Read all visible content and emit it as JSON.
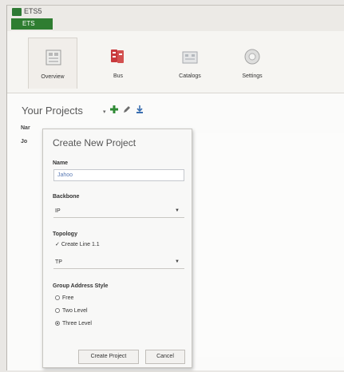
{
  "window": {
    "title": "ETS5"
  },
  "tab_strip": {
    "active_tab": "ETS"
  },
  "ribbon": {
    "tabs": [
      {
        "label": "Overview",
        "icon": "overview-icon",
        "active": true
      },
      {
        "label": "Bus",
        "icon": "bus-icon",
        "active": false
      },
      {
        "label": "Catalogs",
        "icon": "catalogs-icon",
        "active": false
      },
      {
        "label": "Settings",
        "icon": "settings-icon",
        "active": false
      }
    ]
  },
  "projects": {
    "title": "Your Projects",
    "bg_col": "Nar",
    "bg_row": "Jo"
  },
  "dialog": {
    "title": "Create New Project",
    "name_label": "Name",
    "name_value": "Jahoo",
    "backbone_label": "Backbone",
    "backbone_value": "IP",
    "topology_label": "Topology",
    "create_line_label": "Create Line 1.1",
    "topology_value": "TP",
    "group_label": "Group Address Style",
    "radios": [
      {
        "label": "Free",
        "selected": false
      },
      {
        "label": "Two Level",
        "selected": false
      },
      {
        "label": "Three Level",
        "selected": true
      }
    ],
    "create_button": "Create Project",
    "cancel_button": "Cancel"
  },
  "colors": {
    "accent_green": "#2f7d31",
    "red_icon": "#c8393c"
  }
}
